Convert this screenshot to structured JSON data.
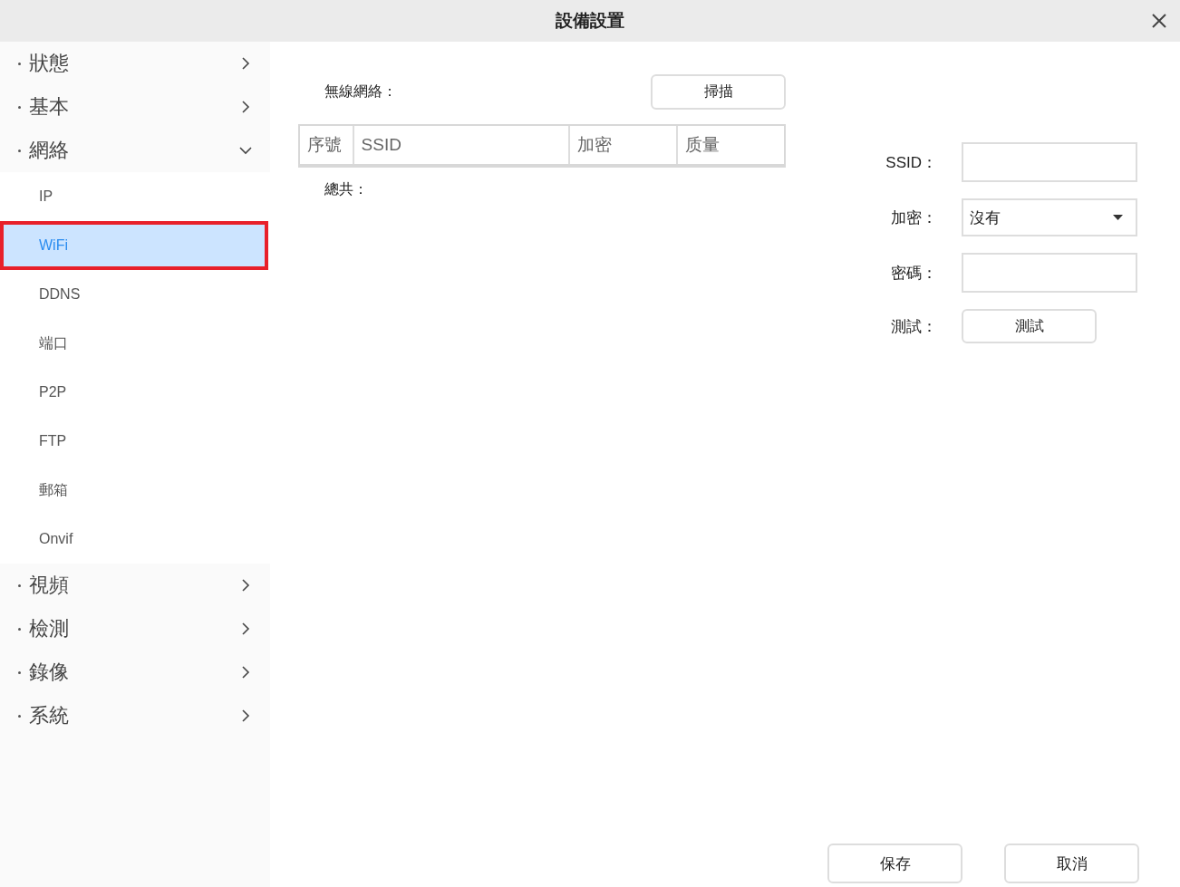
{
  "window": {
    "title": "設備設置"
  },
  "sidebar": {
    "items": [
      {
        "label": "狀態",
        "expanded": false
      },
      {
        "label": "基本",
        "expanded": false
      },
      {
        "label": "網絡",
        "expanded": true,
        "children": [
          {
            "label": "IP",
            "selected": false
          },
          {
            "label": "WiFi",
            "selected": true
          },
          {
            "label": "DDNS",
            "selected": false
          },
          {
            "label": "端口",
            "selected": false
          },
          {
            "label": "P2P",
            "selected": false
          },
          {
            "label": "FTP",
            "selected": false
          },
          {
            "label": "郵箱",
            "selected": false
          },
          {
            "label": "Onvif",
            "selected": false
          }
        ]
      },
      {
        "label": "視頻",
        "expanded": false
      },
      {
        "label": "檢測",
        "expanded": false
      },
      {
        "label": "錄像",
        "expanded": false
      },
      {
        "label": "系統",
        "expanded": false
      }
    ]
  },
  "wifi_list": {
    "label": "無線網絡：",
    "scan_button": "掃描",
    "columns": [
      "序號",
      "SSID",
      "加密",
      "质量"
    ],
    "total_label": "總共："
  },
  "form": {
    "fields": [
      {
        "kind": "input",
        "label": "SSID："
      },
      {
        "kind": "select",
        "label": "加密：",
        "value": "沒有"
      },
      {
        "kind": "input",
        "label": "密碼："
      },
      {
        "kind": "button",
        "label": "測試：",
        "button": "測試"
      }
    ]
  },
  "buttons": [
    "保存",
    "取消"
  ]
}
